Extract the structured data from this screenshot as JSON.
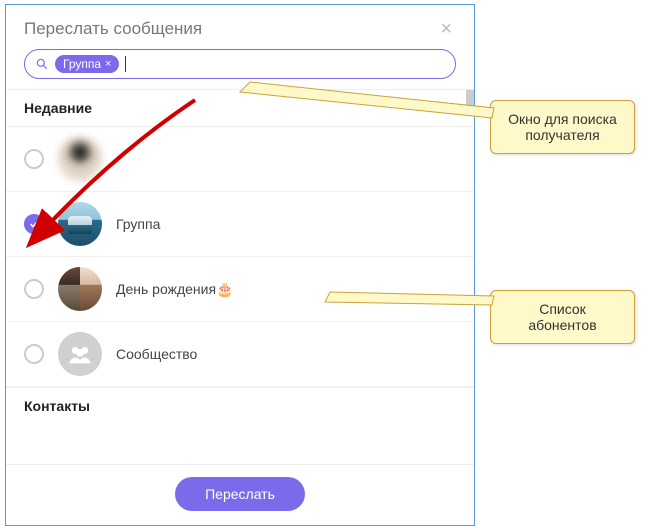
{
  "dialog": {
    "title": "Переслать сообщения",
    "close": "×"
  },
  "search": {
    "chip_label": "Группа",
    "chip_close": "×",
    "placeholder": ""
  },
  "sections": {
    "recent": "Недавние",
    "contacts": "Контакты"
  },
  "items": [
    {
      "label": "",
      "selected": false
    },
    {
      "label": "Группа",
      "selected": true
    },
    {
      "label": "День рождения🎂",
      "selected": false
    },
    {
      "label": "Сообщество",
      "selected": false
    }
  ],
  "footer": {
    "forward": "Переслать"
  },
  "callouts": {
    "search": "Окно для поиска получателя",
    "list": "Список абонентов"
  }
}
